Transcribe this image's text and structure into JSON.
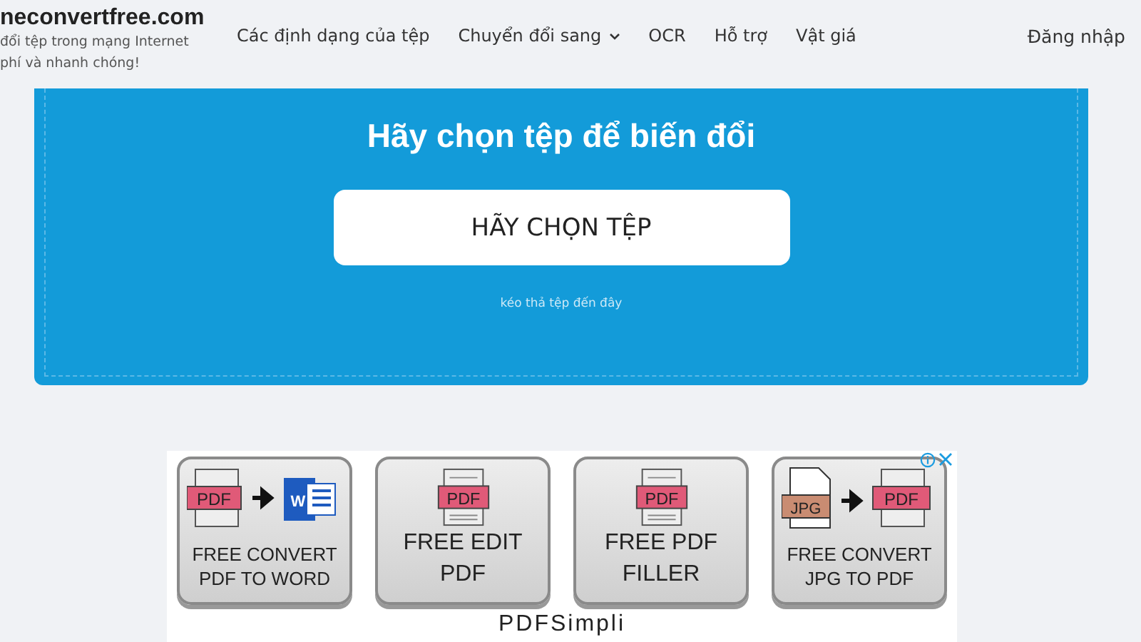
{
  "header": {
    "logo": "neconvertfree.com",
    "tagline_lines": [
      "đổi tệp trong mạng Internet",
      "phí và nhanh chóng!"
    ],
    "nav": [
      {
        "label": "Các định dạng của tệp",
        "dropdown": false
      },
      {
        "label": "Chuyển đổi sang",
        "dropdown": true
      },
      {
        "label": "OCR",
        "dropdown": false
      },
      {
        "label": "Hỗ trợ",
        "dropdown": false
      },
      {
        "label": "Vật giá",
        "dropdown": false
      }
    ],
    "login": "Đăng nhập"
  },
  "upload": {
    "title": "Hãy chọn tệp để biến đổi",
    "button": "HÃY CHỌN TỆP",
    "hint": "kéo thả tệp đến đây"
  },
  "ad": {
    "tiles": [
      {
        "kind": "pdf-to-word",
        "icon_labels": [
          "PDF",
          "W"
        ],
        "lines": [
          "FREE CONVERT",
          "PDF TO WORD"
        ]
      },
      {
        "kind": "pdf",
        "icon_labels": [
          "PDF"
        ],
        "lines": [
          "FREE EDIT",
          "PDF"
        ]
      },
      {
        "kind": "pdf",
        "icon_labels": [
          "PDF"
        ],
        "lines": [
          "FREE PDF",
          "FILLER"
        ]
      },
      {
        "kind": "jpg-to-pdf",
        "icon_labels": [
          "JPG",
          "PDF"
        ],
        "lines": [
          "FREE CONVERT",
          "JPG TO PDF"
        ]
      }
    ],
    "brand": "PDFSimpli"
  }
}
